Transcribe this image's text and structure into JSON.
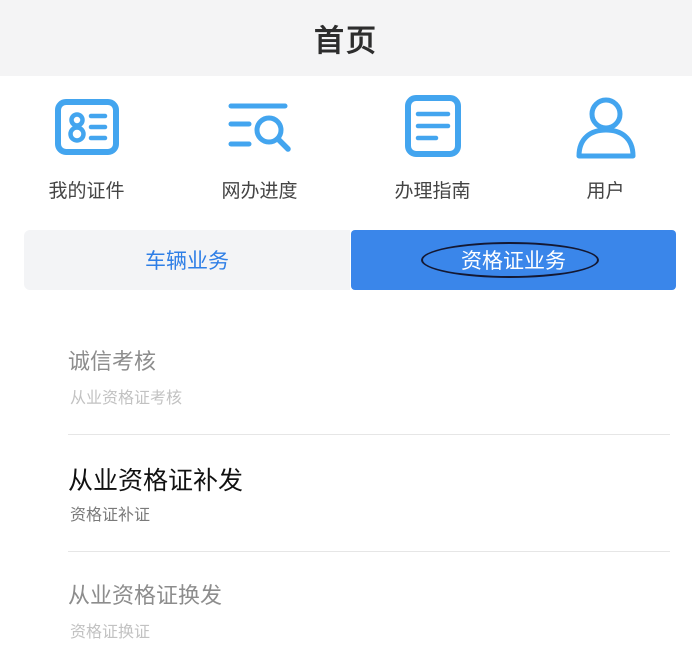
{
  "header": {
    "title": "首页"
  },
  "quick_actions": [
    {
      "label": "我的证件",
      "icon": "id-card-icon"
    },
    {
      "label": "网办进度",
      "icon": "search-list-icon"
    },
    {
      "label": "办理指南",
      "icon": "guide-document-icon"
    },
    {
      "label": "用户",
      "icon": "user-icon"
    }
  ],
  "segments": {
    "vehicle_label": "车辆业务",
    "qualification_label": "资格证业务",
    "selected": "资格证业务"
  },
  "services": [
    {
      "title": "诚信考核",
      "subtitle": "从业资格证考核"
    },
    {
      "title": "从业资格证补发",
      "subtitle": "资格证补证"
    },
    {
      "title": "从业资格证换发",
      "subtitle": "资格证换证"
    }
  ],
  "colors": {
    "accent": "#3a86ea",
    "icon_blue": "#43a5ef",
    "header_bg": "#f4f4f5"
  }
}
